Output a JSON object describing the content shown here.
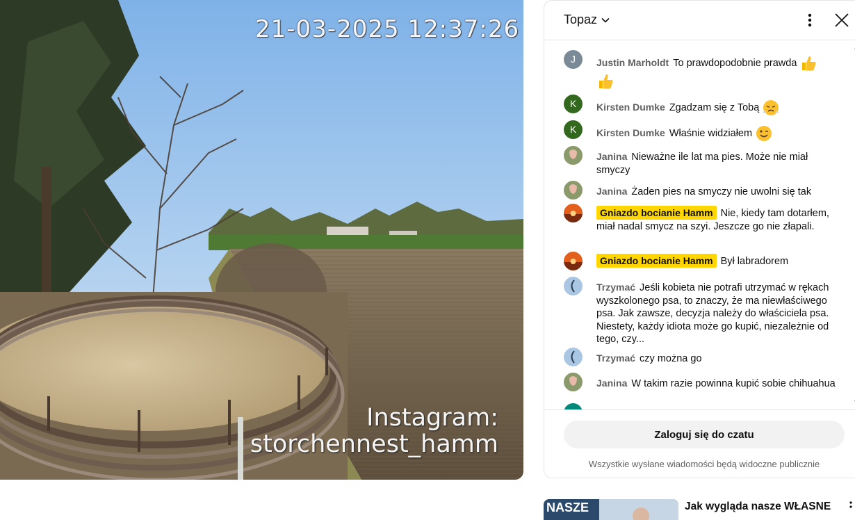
{
  "video": {
    "timestamp": "21-03-2025 12:37:26",
    "overlay_line1": "Instagram:",
    "overlay_line2": "storchennest_hamm"
  },
  "chat": {
    "mode_label": "Topaz",
    "messages": [
      {
        "initial": "J",
        "avatar_color": "#7a8a96",
        "author": "Justin Marholdt",
        "owner": false,
        "text": "To prawdopodobnie prawda",
        "emoji": "thumbs-up-icon"
      },
      {
        "initial": "K",
        "avatar_color": "#33691e",
        "author": "Kirsten Dumke",
        "owner": false,
        "text": "Zgadzam się z Tobą",
        "emoji": "steam-face-icon"
      },
      {
        "initial": "K",
        "avatar_color": "#33691e",
        "author": "Kirsten Dumke",
        "owner": false,
        "text": "Właśnie widziałem",
        "emoji": "wink-face-icon"
      },
      {
        "initial": "",
        "avatar_color": "#b08a7a",
        "author": "Janina",
        "owner": false,
        "text": "Nieważne ile lat ma pies. Może nie miał smyczy"
      },
      {
        "initial": "",
        "avatar_color": "#b08a7a",
        "author": "Janina",
        "owner": false,
        "text": "Żaden pies na smyczy nie uwolni się tak"
      },
      {
        "initial": "",
        "avatar_color": "#e25f1c",
        "author": "Gniazdo bocianie Hamm",
        "owner": true,
        "text": "Nie, kiedy tam dotarłem, miał nadal smycz na szyi. Jeszcze go nie złapali."
      },
      {
        "initial": "",
        "avatar_color": "#e25f1c",
        "author": "Gniazdo bocianie Hamm",
        "owner": true,
        "text": "Był labradorem"
      },
      {
        "initial": "",
        "avatar_color": "#8fb5d6",
        "author": "Trzymać",
        "owner": false,
        "text": "Jeśli kobieta nie potrafi utrzymać w rękach wyszkolonego psa, to znaczy, że ma niewłaściwego psa. Jak zawsze, decyzja należy do właściciela psa. Niestety, każdy idiota może go kupić, niezależnie od tego, czy..."
      },
      {
        "initial": "",
        "avatar_color": "#8fb5d6",
        "author": "Trzymać",
        "owner": false,
        "text": "czy można go"
      },
      {
        "initial": "",
        "avatar_color": "#b08a7a",
        "author": "Janina",
        "owner": false,
        "text": "W takim razie powinna kupić sobie chihuahua"
      }
    ],
    "login_label": "Zaloguj się do czatu",
    "notice": "Wszystkie wysłane wiadomości będą widoczne publicznie"
  },
  "recommendation": {
    "thumb_text": "NASZE",
    "title": "Jak wygląda nasze WŁASNE"
  },
  "colors": {
    "owner_badge": "#ffd600",
    "jump_button": "#2196f3",
    "author_text": "#606060"
  }
}
